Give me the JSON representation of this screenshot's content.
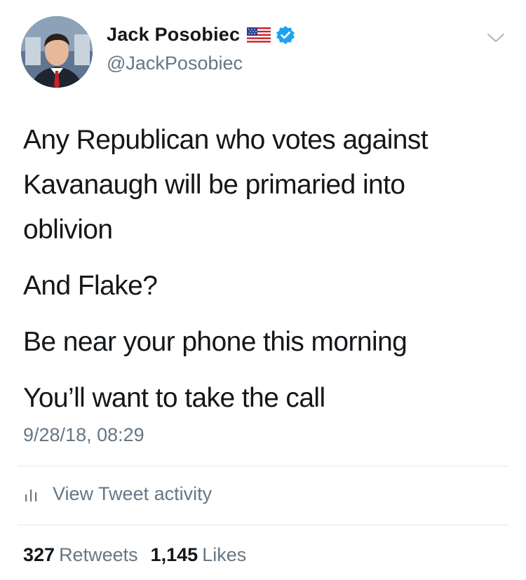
{
  "user": {
    "display_name": "Jack Posobiec",
    "handle": "@JackPosobiec",
    "flag_emoji_name": "us-flag-icon",
    "verified_color": "#1da1f2"
  },
  "tweet": {
    "paragraphs": [
      "Any Republican who votes against Kavanaugh will be primaried into oblivion",
      "And Flake?",
      "Be near your phone this morning",
      "You’ll want to take the call"
    ],
    "timestamp": "9/28/18, 08:29"
  },
  "activity": {
    "label": "View Tweet activity"
  },
  "stats": {
    "retweets_count": "327",
    "retweets_label": "Retweets",
    "likes_count": "1,145",
    "likes_label": "Likes"
  },
  "colors": {
    "text_primary": "#14171a",
    "text_secondary": "#657786",
    "divider": "#e1e8ed",
    "accent": "#1da1f2"
  }
}
